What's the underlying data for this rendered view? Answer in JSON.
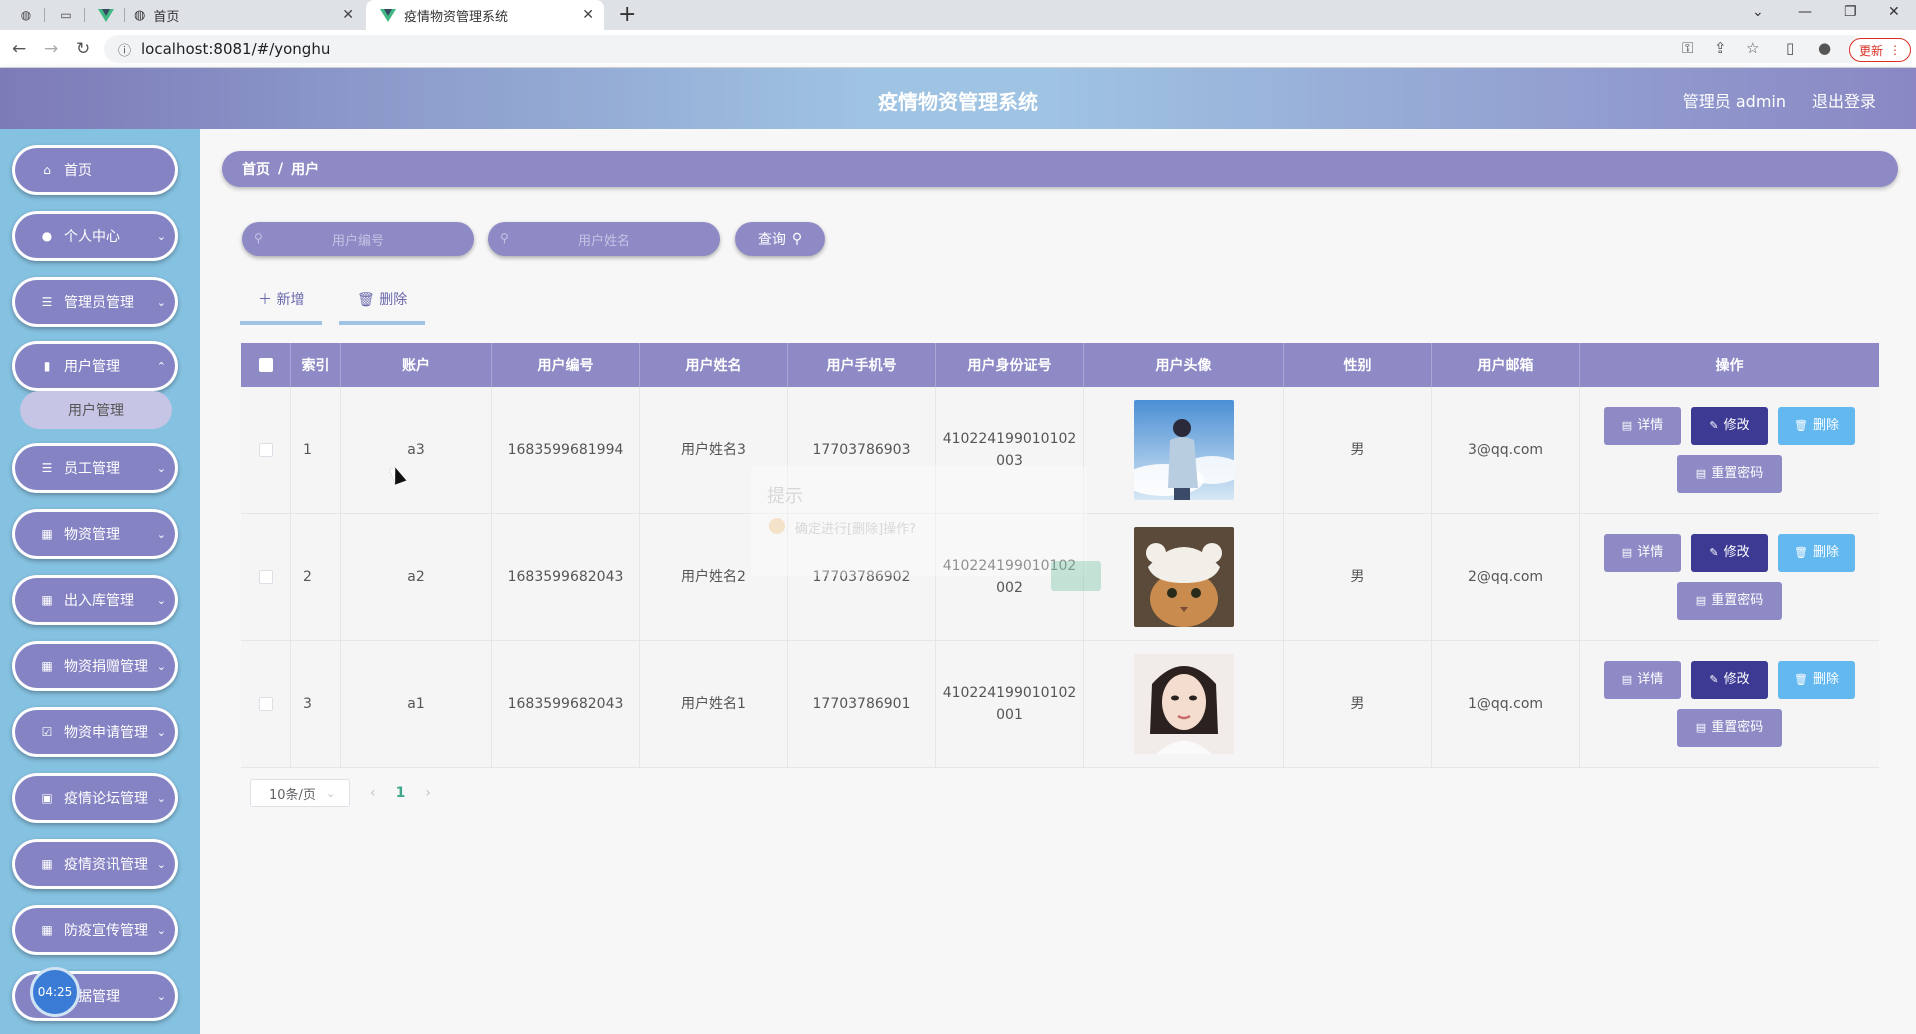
{
  "browser": {
    "tabs": [
      {
        "title": "首页"
      },
      {
        "title": "疫情物资管理系统"
      }
    ],
    "url": "localhost:8081/#/yonghu",
    "update_label": "更新"
  },
  "header": {
    "title": "疫情物资管理系统",
    "user_label": "管理员 admin",
    "logout_label": "退出登录"
  },
  "sidebar": {
    "items": [
      {
        "label": "首页",
        "icon": "home-icon"
      },
      {
        "label": "个人中心",
        "icon": "user-icon"
      },
      {
        "label": "管理员管理",
        "icon": "list-icon"
      },
      {
        "label": "用户管理",
        "icon": "chart-icon"
      },
      {
        "label": "员工管理",
        "icon": "list-icon"
      },
      {
        "label": "物资管理",
        "icon": "grid-icon"
      },
      {
        "label": "出入库管理",
        "icon": "grid-icon"
      },
      {
        "label": "物资捐赠管理",
        "icon": "grid-icon"
      },
      {
        "label": "物资申请管理",
        "icon": "check-icon"
      },
      {
        "label": "疫情论坛管理",
        "icon": "clipboard-icon"
      },
      {
        "label": "疫情资讯管理",
        "icon": "grid-icon"
      },
      {
        "label": "防疫宣传管理",
        "icon": "grid-icon"
      },
      {
        "label": "数据管理",
        "icon": "grid-icon"
      }
    ],
    "submenu_active": "用户管理",
    "timer": "04:25"
  },
  "breadcrumb": {
    "home": "首页",
    "sep": "/",
    "current": "用户"
  },
  "search": {
    "user_no_placeholder": "用户编号",
    "user_name_placeholder": "用户姓名",
    "query_label": "查询"
  },
  "actions": {
    "add_label": "新增",
    "delete_label": "删除"
  },
  "table": {
    "headers": [
      "索引",
      "账户",
      "用户编号",
      "用户姓名",
      "用户手机号",
      "用户身份证号",
      "用户头像",
      "性别",
      "用户邮箱",
      "操作"
    ],
    "rows": [
      {
        "index": "1",
        "account": "a3",
        "user_no": "1683599681994",
        "name": "用户姓名3",
        "phone": "17703786903",
        "id_card_1": "410224199010102",
        "id_card_2": "003",
        "gender": "男",
        "email": "3@qq.com"
      },
      {
        "index": "2",
        "account": "a2",
        "user_no": "1683599682043",
        "name": "用户姓名2",
        "phone": "17703786902",
        "id_card_1": "410224199010102",
        "id_card_2": "002",
        "gender": "男",
        "email": "2@qq.com"
      },
      {
        "index": "3",
        "account": "a1",
        "user_no": "1683599682043",
        "name": "用户姓名1",
        "phone": "17703786901",
        "id_card_1": "410224199010102",
        "id_card_2": "001",
        "gender": "男",
        "email": "1@qq.com"
      }
    ],
    "ops": {
      "detail": "详情",
      "edit": "修改",
      "delete": "删除",
      "reset": "重置密码"
    }
  },
  "pager": {
    "page_size": "10条/页",
    "current_page": "1"
  },
  "dialog": {
    "title": "提示",
    "message": "确定进行[删除]操作?",
    "ok": "确定"
  }
}
